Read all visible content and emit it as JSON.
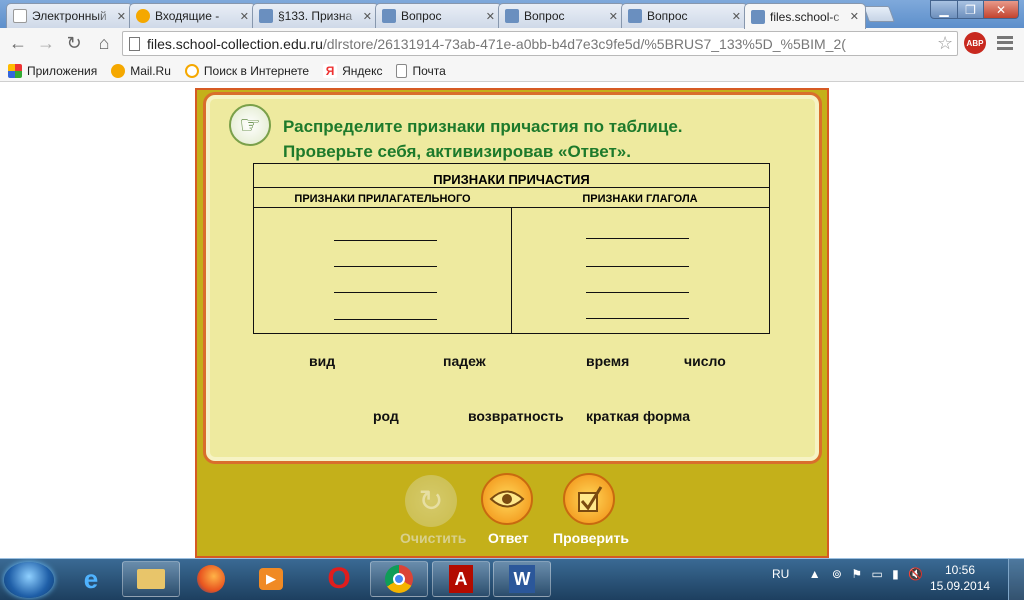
{
  "browser": {
    "tabs": [
      {
        "label": "Электронный",
        "icon": "doc-icon",
        "color": "#ffffff"
      },
      {
        "label": "Входящие -",
        "icon": "mailru-icon",
        "color": "#f5a800"
      },
      {
        "label": "§133. Призна",
        "icon": "site-icon",
        "color": "#6a8fbf"
      },
      {
        "label": "Вопрос",
        "icon": "site-icon",
        "color": "#6a8fbf"
      },
      {
        "label": "Вопрос",
        "icon": "site-icon",
        "color": "#6a8fbf"
      },
      {
        "label": "Вопрос",
        "icon": "site-icon",
        "color": "#6a8fbf"
      },
      {
        "label": "files.school-c",
        "icon": "site-icon",
        "color": "#6a8fbf",
        "active": true
      }
    ],
    "url_host": "files.school-collection.edu.ru",
    "url_path": "/dlrstore/26131914-73ab-471e-a0bb-b4d7e3c9fe5d/%5BRUS7_133%5D_%5BIM_2(",
    "bookmarks": [
      {
        "label": "Приложения",
        "icon": "apps-icon"
      },
      {
        "label": "Mail.Ru",
        "icon": "mailru-icon"
      },
      {
        "label": "Поиск в Интернете",
        "icon": "search-icon"
      },
      {
        "label": "Яндекс",
        "icon": "yandex-icon"
      },
      {
        "label": "Почта",
        "icon": "page-icon"
      }
    ],
    "adblock_label": "ABP"
  },
  "exercise": {
    "instruction_line1": "Распределите признаки причастия по таблице.",
    "instruction_line2": "Проверьте себя, активизировав «Ответ».",
    "table_title": "ПРИЗНАКИ ПРИЧАСТИЯ",
    "col_left": "ПРИЗНАКИ ПРИЛАГАТЕЛЬНОГО",
    "col_right": "ПРИЗНАКИ ГЛАГОЛА",
    "words": [
      "вид",
      "падеж",
      "время",
      "число",
      "род",
      "возвратность",
      "краткая форма"
    ],
    "buttons": {
      "clear": "Очистить",
      "answer": "Ответ",
      "check": "Проверить"
    },
    "colors": {
      "instruction": "#1d7a2b",
      "panel": "#eeea9f",
      "frame": "#c4b01a",
      "border": "#d96e2c"
    }
  },
  "taskbar": {
    "apps": [
      "ie-icon",
      "explorer-icon",
      "firefox-icon",
      "media-icon",
      "opera-icon",
      "chrome-icon",
      "acrobat-icon",
      "word-icon"
    ],
    "language": "RU",
    "time": "10:56",
    "date": "15.09.2014"
  }
}
